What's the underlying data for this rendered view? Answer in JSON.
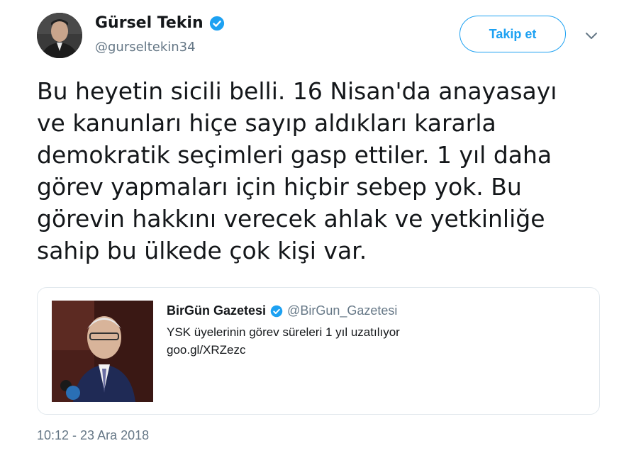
{
  "author": {
    "name": "Gürsel Tekin",
    "handle": "@gurseltekin34",
    "verified": true
  },
  "follow_button": {
    "label": "Takip et"
  },
  "tweet": {
    "text": "Bu heyetin sicili belli. 16 Nisan'da anayasayı\nve kanunları hiçe sayıp aldıkları kararla\ndemokratik seçimleri gasp ettiler. 1 yıl daha\ngörev yapmaları için hiçbir sebep yok. Bu\ngörevin hakkını verecek ahlak ve yetkinliğe\nsahip bu ülkede çok kişi var.",
    "timestamp": "10:12 - 23 Ara 2018"
  },
  "quoted_tweet": {
    "name": "BirGün Gazetesi",
    "handle": "@BirGun_Gazetesi",
    "verified": true,
    "text": "YSK üyelerinin görev süreleri 1 yıl uzatılıyor\ngoo.gl/XRZezc"
  },
  "colors": {
    "accent": "#1da1f2",
    "text": "#14171a",
    "muted": "#657786",
    "border": "#e1e8ed"
  },
  "icons": {
    "verified": "verified-badge-icon",
    "caret": "chevron-down-icon"
  }
}
